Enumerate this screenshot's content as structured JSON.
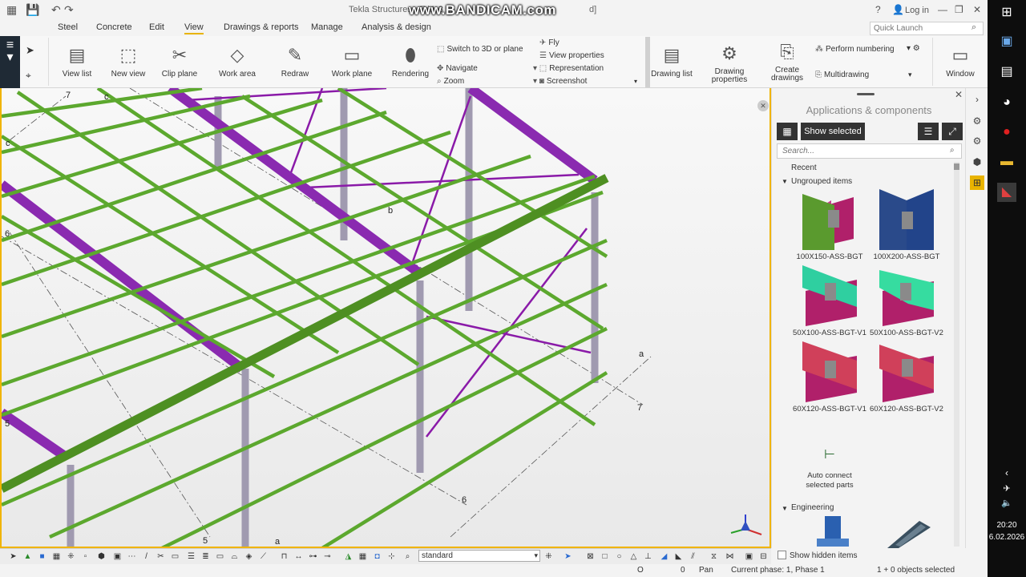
{
  "titlebar": {
    "title": "Tekla Structures - E:\\1-3",
    "title_end": "d]",
    "watermark": "www.BANDICAM.com",
    "help": "?",
    "login": "Log in"
  },
  "menu": {
    "items": [
      "Steel",
      "Concrete",
      "Edit",
      "View",
      "Drawings & reports",
      "Manage",
      "Analysis & design"
    ],
    "active": "View",
    "quick_launch_placeholder": "Quick Launch"
  },
  "ribbon": {
    "view_list": "View list",
    "new_view": "New view",
    "clip_plane": "Clip plane",
    "work_area": "Work area",
    "redraw": "Redraw",
    "work_plane": "Work plane",
    "rendering": "Rendering",
    "switch_3d": "Switch to 3D or plane",
    "navigate": "Navigate",
    "zoom": "Zoom",
    "fly": "Fly",
    "view_properties": "View properties",
    "representation": "Representation",
    "screenshot": "Screenshot",
    "drawing_list": "Drawing list",
    "drawing_properties_1": "Drawing",
    "drawing_properties_2": "properties",
    "create_drawings_1": "Create",
    "create_drawings_2": "drawings",
    "perform_numbering": "Perform numbering",
    "multidrawing": "Multidrawing",
    "window": "Window"
  },
  "viewport": {
    "grid_labels": [
      "7",
      "c",
      "c",
      "6",
      "b",
      "a",
      "7",
      "5",
      "5",
      "6",
      "a"
    ]
  },
  "panel": {
    "title": "Applications & components",
    "show_selected": "Show selected",
    "search_placeholder": "Search...",
    "recent": "Recent",
    "ungrouped": "Ungrouped items",
    "components": [
      {
        "label": "100X150-ASS-BGT",
        "color": "#5a9a2e"
      },
      {
        "label": "100X200-ASS-BGT",
        "color": "#2a4a8a"
      },
      {
        "label": "50X100-ASS-BGT-V1",
        "color": "#2fcfa0"
      },
      {
        "label": "50X100-ASS-BGT-V2",
        "color": "#36dca0"
      },
      {
        "label": "60X120-ASS-BGT-V1",
        "color": "#d0405a"
      },
      {
        "label": "60X120-ASS-BGT-V2",
        "color": "#d0405a"
      }
    ],
    "auto_connect_1": "Auto connect",
    "auto_connect_2": "selected parts",
    "engineering": "Engineering",
    "show_hidden": "Show hidden items"
  },
  "bottombar": {
    "standard": "standard"
  },
  "status": {
    "o": "O",
    "zero": "0",
    "pan": "Pan",
    "phase": "Current phase: 1, Phase 1",
    "selected": "1 + 0 objects selected"
  },
  "taskbar": {
    "time": "20:20",
    "date": "6.02.2026"
  }
}
